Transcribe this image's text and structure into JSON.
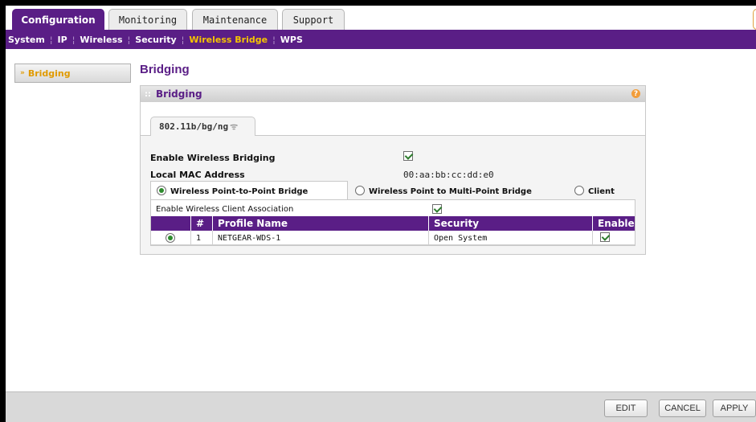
{
  "tabs": [
    "Configuration",
    "Monitoring",
    "Maintenance",
    "Support"
  ],
  "active_tab": "Configuration",
  "subnav": [
    "System",
    "IP",
    "Wireless",
    "Security",
    "Wireless Bridge",
    "WPS"
  ],
  "active_subnav": "Wireless Bridge",
  "sidebar": {
    "items": [
      {
        "label": "Bridging"
      }
    ]
  },
  "page_title": "Bridging",
  "panel": {
    "title": "Bridging",
    "mode_tab": "802.11b/bg/ng",
    "fields": {
      "enable_bridging_label": "Enable Wireless Bridging",
      "enable_bridging_checked": true,
      "mac_label": "Local MAC Address",
      "mac_value": "00:aa:bb:cc:dd:e0"
    },
    "modes": [
      {
        "label": "Wireless Point-to-Point Bridge",
        "selected": true
      },
      {
        "label": "Wireless Point to Multi-Point Bridge",
        "selected": false
      },
      {
        "label": "Client",
        "selected": false
      }
    ],
    "client_assoc_label": "Enable Wireless Client Association",
    "client_assoc_checked": true,
    "table": {
      "headers": [
        "#",
        "Profile Name",
        "Security",
        "Enable"
      ],
      "rows": [
        {
          "selected": true,
          "num": "1",
          "profile": "NETGEAR-WDS-1",
          "security": "Open System",
          "enabled": true
        }
      ]
    }
  },
  "buttons": {
    "edit": "EDIT",
    "cancel": "CANCEL",
    "apply": "APPLY"
  },
  "colors": {
    "brand_purple": "#5a1e86",
    "active_subnav": "#f5c400",
    "sidebar_accent": "#e09a00",
    "help_orange": "#f29d3a"
  }
}
